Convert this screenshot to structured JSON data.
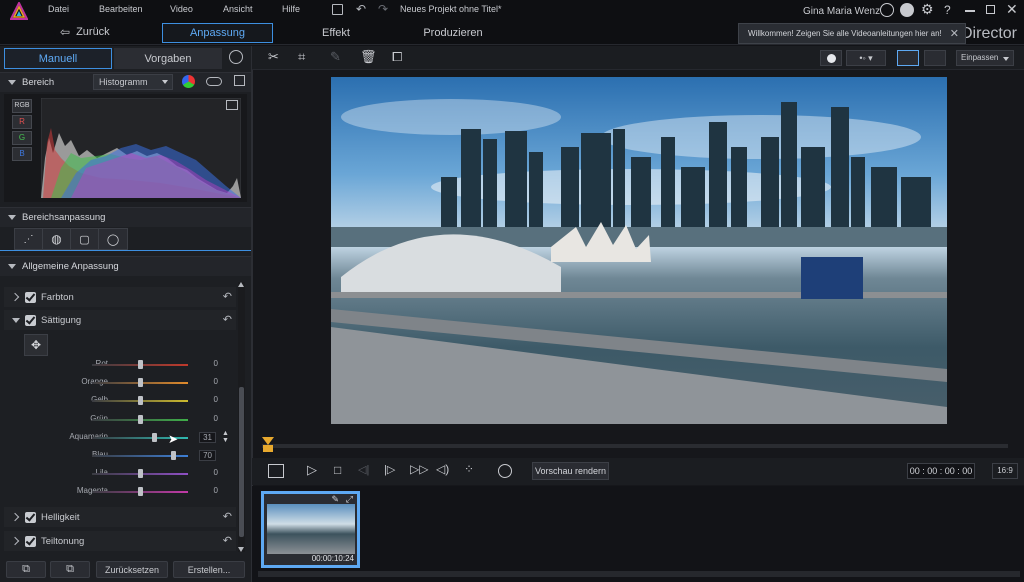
{
  "menu": {
    "items": [
      "Datei",
      "Bearbeiten",
      "Video",
      "Ansicht",
      "Hilfe"
    ],
    "project_title": "Neues Projekt ohne Titel*",
    "user": "Gina Maria Wenz"
  },
  "modes": {
    "back": "Zurück",
    "tabs": [
      "Anpassung",
      "Effekt",
      "Produzieren"
    ],
    "active": "Anpassung",
    "brand_suffix": "Director"
  },
  "notification": {
    "text": "Willkommen! Zeigen Sie alle Videoanleitungen hier an!"
  },
  "left_panel": {
    "tabs": {
      "manual": "Manuell",
      "presets": "Vorgaben"
    },
    "range_section": {
      "title": "Bereich",
      "dropdown": "Histogramm"
    },
    "histogram_channels": [
      "RGB",
      "R",
      "G",
      "B"
    ],
    "range_adjust_title": "Bereichsanpassung",
    "general_title": "Allgemeine Anpassung",
    "farbton": "Farbton",
    "saettigung": "Sättigung",
    "helligkeit": "Helligkeit",
    "teiltonung": "Teiltonung",
    "sliders": [
      {
        "label": "Rot",
        "value": "0",
        "level": 0.5,
        "color": "#c0392b"
      },
      {
        "label": "Orange",
        "value": "0",
        "level": 0.5,
        "color": "#e08a2b"
      },
      {
        "label": "Gelb",
        "value": "0",
        "level": 0.5,
        "color": "#cdbb2e"
      },
      {
        "label": "Grün",
        "value": "0",
        "level": 0.5,
        "color": "#3fae49"
      },
      {
        "label": "Aquamarin",
        "value": "31",
        "level": 0.655,
        "color": "#2fb9b0"
      },
      {
        "label": "Blau",
        "value": "70",
        "level": 0.85,
        "color": "#3d7fd6"
      },
      {
        "label": "Lila",
        "value": "0",
        "level": 0.5,
        "color": "#8e4fc4"
      },
      {
        "label": "Magenta",
        "value": "0",
        "level": 0.5,
        "color": "#c23aa8"
      }
    ],
    "reset_btn": "Zurücksetzen",
    "create_btn": "Erstellen..."
  },
  "preview": {
    "fit_dropdown": "Einpassen"
  },
  "player": {
    "render_preview": "Vorschau rendern",
    "timecode": "00 : 00 : 00 : 00",
    "ratio": "16:9"
  },
  "timeline": {
    "clip_duration": "00:00:10:24"
  },
  "colors": {
    "accent": "#3d8fe0",
    "panel": "#1d1f23",
    "playhead": "#e8a92e"
  }
}
